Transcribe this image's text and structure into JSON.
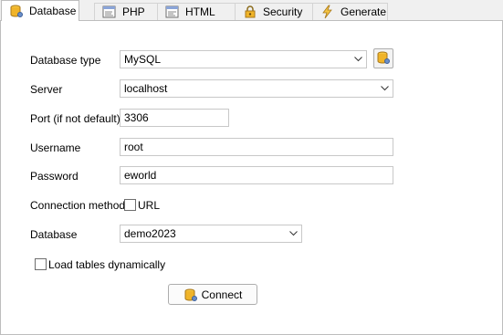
{
  "tabs": [
    {
      "label": "Database",
      "icon": "database-icon",
      "active": true
    },
    {
      "label": "PHP",
      "icon": "php-icon",
      "active": false
    },
    {
      "label": "HTML",
      "icon": "html-icon",
      "active": false
    },
    {
      "label": "Security",
      "icon": "lock-icon",
      "active": false
    },
    {
      "label": "Generate",
      "icon": "lightning-icon",
      "active": false
    }
  ],
  "form": {
    "database_type": {
      "label": "Database type",
      "value": "MySQL"
    },
    "server": {
      "label": "Server",
      "value": "localhost"
    },
    "port": {
      "label": "Port (if not default)",
      "value": "3306"
    },
    "username": {
      "label": "Username",
      "value": "root"
    },
    "password": {
      "label": "Password",
      "value": "eworld"
    },
    "connection_method": {
      "label": "Connection method",
      "option_label": "URL",
      "checked": false
    },
    "database": {
      "label": "Database",
      "value": "demo2023"
    },
    "load_tables": {
      "label": "Load tables dynamically",
      "checked": false
    }
  },
  "connect_button": {
    "label": "Connect",
    "icon": "database-icon"
  },
  "colors": {
    "accent": "#e8a317",
    "tab_border": "#bdbdbd",
    "panel_bg": "#ffffff",
    "window_bg": "#f0f0f0"
  }
}
